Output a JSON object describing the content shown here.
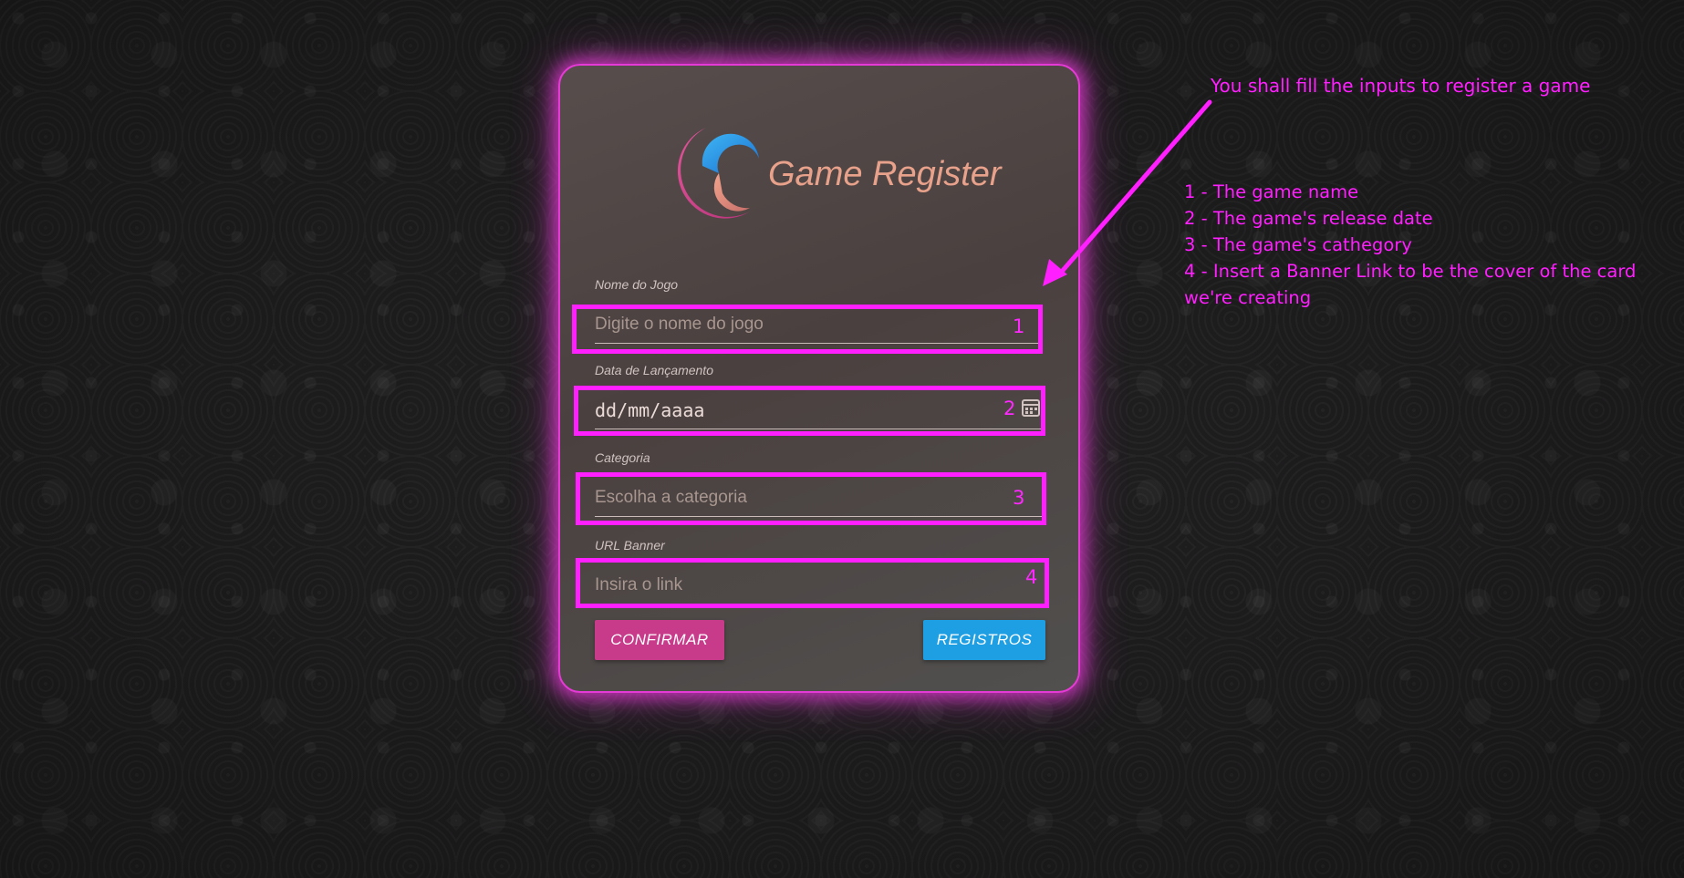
{
  "app": {
    "title": "Game Register"
  },
  "form": {
    "name_label": "Nome do Jogo",
    "name_placeholder": "Digite o nome do jogo",
    "date_label": "Data de Lançamento",
    "date_placeholder": "dd/mm/aaaa",
    "category_label": "Categoria",
    "category_placeholder": "Escolha a categoria",
    "banner_label": "URL Banner",
    "banner_placeholder": "Insira o link"
  },
  "buttons": {
    "confirm": "CONFIRMAR",
    "records": "REGISTROS"
  },
  "markers": [
    "1",
    "2",
    "3",
    "4"
  ],
  "annotation": {
    "headline": "You shall fill the inputs to register a game",
    "items": [
      "1 - The game name",
      "2 - The game's release date",
      "3 - The game's cathegory",
      "4 - Insert a Banner Link to be the cover of the card",
      "we're creating"
    ]
  },
  "colors": {
    "accent_highlight": "#ff1fff",
    "confirm_button": "#c83a8a",
    "records_button": "#1e9fe3",
    "title_text": "#e8a18a"
  }
}
